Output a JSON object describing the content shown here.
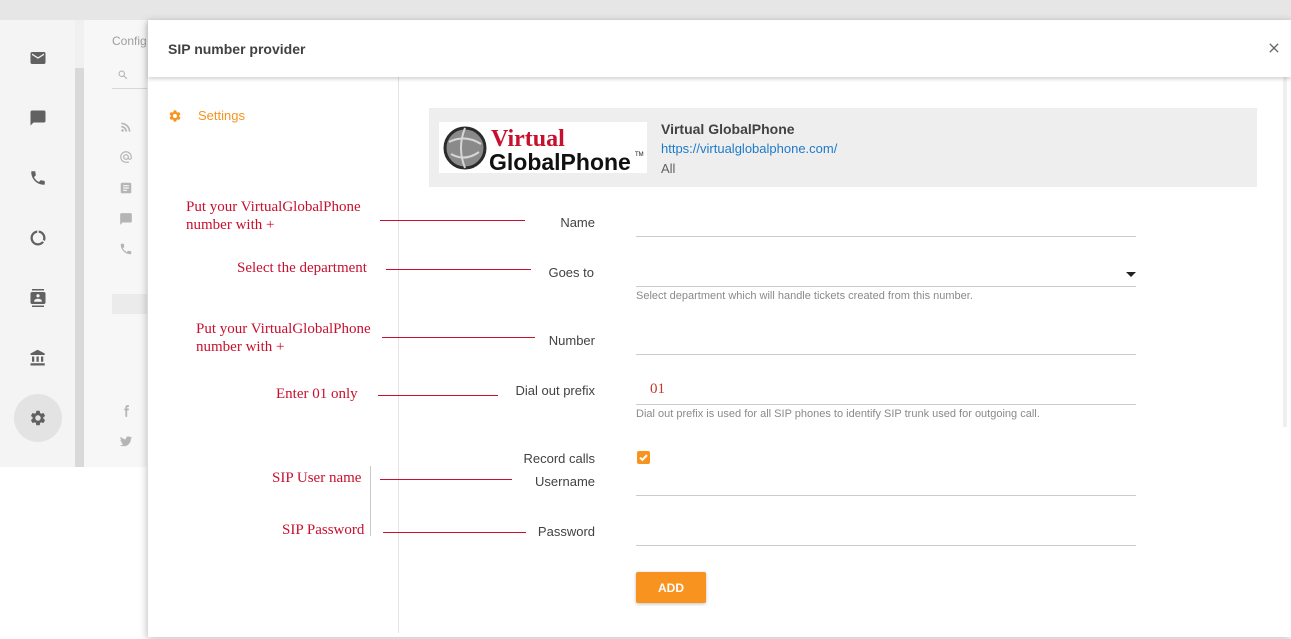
{
  "background": {
    "config_label": "Config",
    "rail_icons": [
      "mail-icon",
      "chat-icon",
      "phone-icon",
      "reports-icon",
      "contacts-icon",
      "bank-icon",
      "gear-icon"
    ],
    "sub_icons": [
      "rss-icon",
      "at-icon",
      "document-icon",
      "chat-icon",
      "phone-icon",
      "facebook-icon",
      "twitter-icon"
    ]
  },
  "modal": {
    "title": "SIP number provider",
    "nav": {
      "settings_label": "Settings"
    },
    "provider": {
      "logo_line1": "Virtual",
      "logo_line2": "GlobalPhone",
      "logo_tm": "TM",
      "name": "Virtual GlobalPhone",
      "url": "https://virtualglobalphone.com/",
      "scope": "All"
    },
    "form": {
      "name": {
        "label": "Name",
        "value": ""
      },
      "goes_to": {
        "label": "Goes to",
        "value": "",
        "hint": "Select department which will handle tickets created from this number."
      },
      "number": {
        "label": "Number",
        "value": ""
      },
      "dial_out_prefix": {
        "label": "Dial out prefix",
        "value": "01",
        "hint": "Dial out prefix is used for all SIP phones to identify SIP trunk used for outgoing call."
      },
      "record_calls": {
        "label": "Record calls",
        "checked": true
      },
      "username": {
        "label": "Username",
        "value": ""
      },
      "password": {
        "label": "Password",
        "value": ""
      },
      "add_label": "ADD"
    }
  },
  "annotations": {
    "name_line1": "Put your VirtualGlobalPhone",
    "name_line2": "number with +",
    "goes_to": "Select the department",
    "number_line1": "Put your VirtualGlobalPhone",
    "number_line2": "number with +",
    "dial_out": "Enter 01 only",
    "sip_user": "SIP User name",
    "sip_password": "SIP Password"
  },
  "colors": {
    "accent": "#f7931e",
    "link": "#1e7bc9",
    "annotation": "#c8102e"
  }
}
